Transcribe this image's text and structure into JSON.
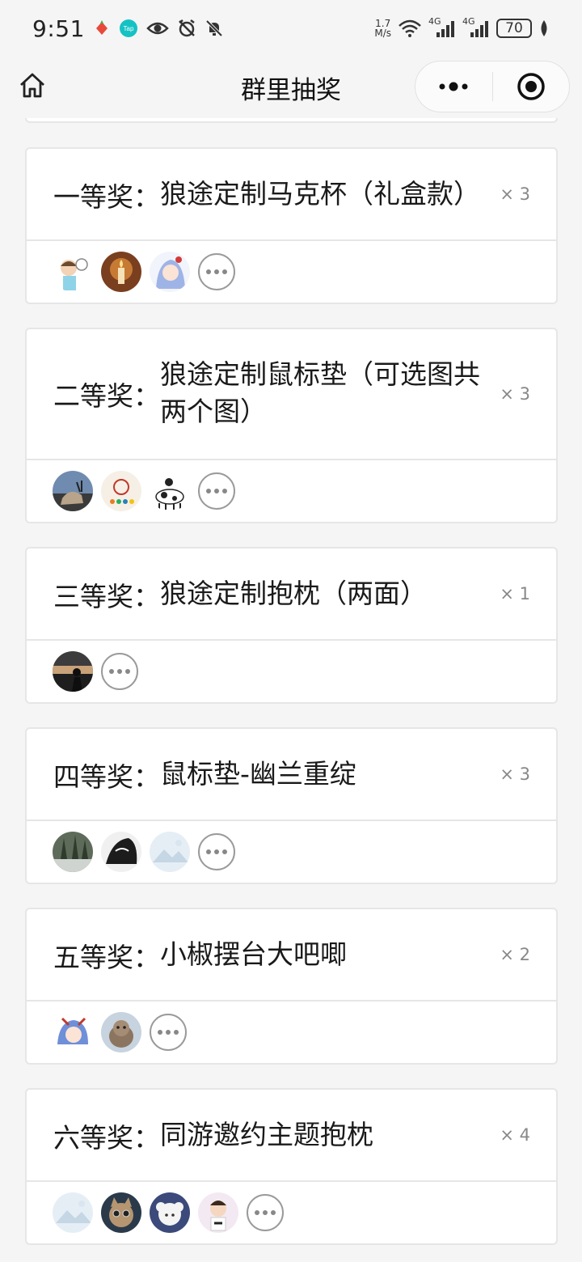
{
  "status_bar": {
    "time": "9:51",
    "net_speed_top": "1.7",
    "net_speed_bottom": "M/s",
    "signal_1": "4G",
    "signal_2": "4G",
    "battery": "70"
  },
  "nav": {
    "title": "群里抽奖"
  },
  "prizes": [
    {
      "level": "一等奖：",
      "name": "狼途定制马克杯（礼盒款）",
      "count": "× 3",
      "avatars": [
        "avatar-cartoon-boy",
        "avatar-candle",
        "avatar-anime-girl"
      ]
    },
    {
      "level": "二等奖：",
      "name": "狼途定制鼠标垫（可选图共两个图）",
      "count": "× 3",
      "avatars": [
        "avatar-wolf",
        "avatar-lantern",
        "avatar-cow"
      ]
    },
    {
      "level": "三等奖：",
      "name": "狼途定制抱枕（两面）",
      "count": "× 1",
      "avatars": [
        "avatar-sunset"
      ]
    },
    {
      "level": "四等奖：",
      "name": "鼠标垫-幽兰重绽",
      "count": "× 3",
      "avatars": [
        "avatar-trees",
        "avatar-monochrome",
        "avatar-placeholder"
      ]
    },
    {
      "level": "五等奖：",
      "name": "小椒摆台大吧唧",
      "count": "× 2",
      "avatars": [
        "avatar-anime-blue",
        "avatar-otter"
      ]
    },
    {
      "level": "六等奖：",
      "name": "同游邀约主题抱枕",
      "count": "× 4",
      "avatars": [
        "avatar-placeholder",
        "avatar-cat",
        "avatar-sheep",
        "avatar-cartoon-kid"
      ]
    }
  ],
  "colors": {
    "background": "#f5f5f5",
    "card_border": "#e6e6e6",
    "count_text": "#888888"
  }
}
